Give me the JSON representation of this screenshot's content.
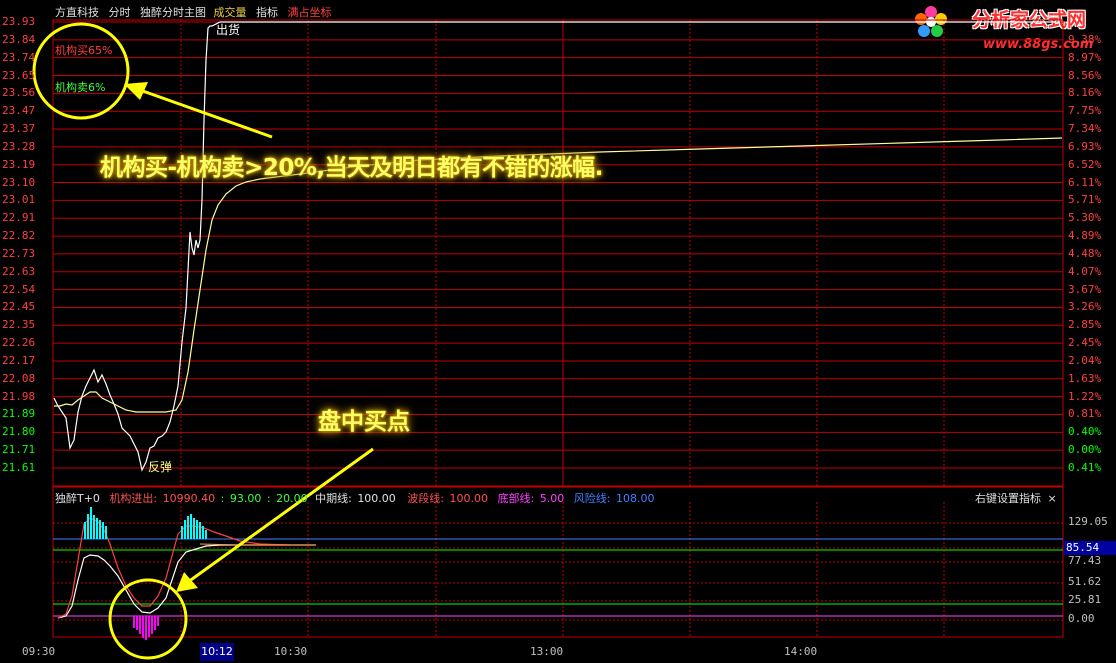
{
  "toolbar": {
    "stock_name": "方直科技",
    "tab_fenshi": "分时",
    "tab_main": "独醉分时主图",
    "tab_volume": "成交量",
    "tab_indicator": "指标",
    "tab_fullscreen": "满占坐标"
  },
  "watermark": {
    "title": "分析家公式网",
    "url": "www.88gs.com"
  },
  "legend": {
    "buy": "机构买65%",
    "sell": "机构卖6%"
  },
  "annotations": {
    "chuhuo": "出货",
    "fantan": "反弹",
    "headline": "机构买-机构卖>20%,当天及明日都有不错的涨幅.",
    "buypoint": "盘中买点"
  },
  "price_axis": {
    "left": [
      "23.93",
      "23.84",
      "23.74",
      "23.65",
      "23.56",
      "23.47",
      "23.37",
      "23.28",
      "23.19",
      "23.10",
      "23.01",
      "22.91",
      "22.82",
      "22.73",
      "22.63",
      "22.54",
      "22.45",
      "22.35",
      "22.26",
      "22.17",
      "22.08",
      "21.98",
      "21.89",
      "21.80",
      "21.71",
      "21.61"
    ],
    "right": [
      "9.38%",
      "8.97%",
      "8.56%",
      "8.16%",
      "7.75%",
      "7.34%",
      "6.93%",
      "6.52%",
      "6.11%",
      "5.71%",
      "5.30%",
      "4.89%",
      "4.48%",
      "4.07%",
      "3.67%",
      "3.26%",
      "2.85%",
      "2.45%",
      "2.04%",
      "1.63%",
      "1.22%",
      "0.81%",
      "0.40%",
      "0.00%",
      "0.41%"
    ]
  },
  "indicator": {
    "name": "独醉T+0",
    "jg_label": "机构进出:",
    "jg_v1": "10990.40",
    "jg_v2": "93.00",
    "jg_v3": "20.00",
    "mid_label": "中期线:",
    "mid_value": "100.00",
    "wave_label": "波段线:",
    "wave_value": "100.00",
    "bottom_label": "底部线:",
    "bottom_value": "5.00",
    "risk_label": "风险线:",
    "risk_value": "108.00",
    "settings": "右键设置指标",
    "close": "×",
    "axis": [
      "129.05",
      "103.44",
      "77.43",
      "51.62",
      "25.81",
      "0.00"
    ],
    "current_value": "85.54"
  },
  "time_axis": {
    "t0930": "09:30",
    "cursor": "10:12",
    "t1030": "10:30",
    "t1300": "13:00",
    "t1400": "14:00"
  },
  "colors": {
    "grid": "#c00000",
    "price": "#ffffff",
    "avg": "#ffff99",
    "highlight": "#ffff00",
    "up": "#ff4040",
    "down": "#00ff00",
    "cyan": "#00ffff",
    "magenta": "#ff00ff"
  }
}
